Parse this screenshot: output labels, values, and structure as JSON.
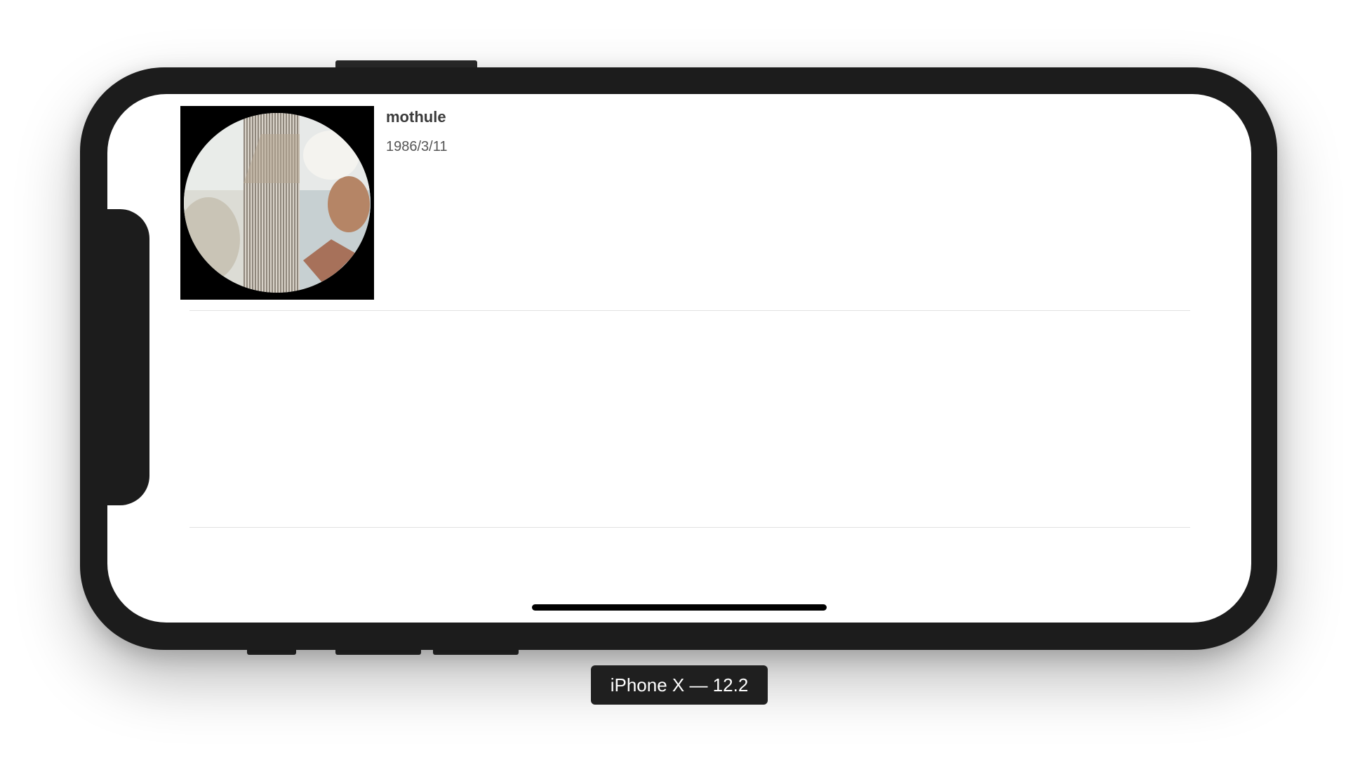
{
  "list": {
    "rows": [
      {
        "name": "mothule",
        "date": "1986/3/11",
        "thumbnail_icon": "photo-thumbnail"
      }
    ]
  },
  "device_label": "iPhone X — 12.2",
  "colors": {
    "device_frame": "#1c1c1c",
    "screen_background": "#ffffff",
    "separator": "#e2e2e2",
    "name_text": "#3a3a3a",
    "date_text": "#555555",
    "label_background": "#1f1f1f",
    "label_text": "#ffffff"
  }
}
